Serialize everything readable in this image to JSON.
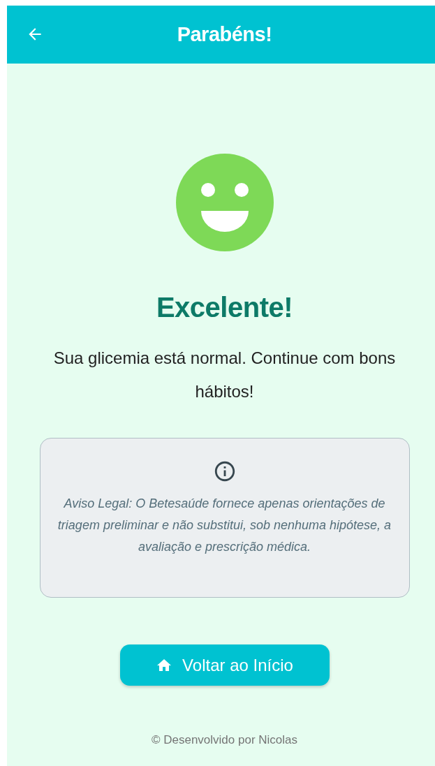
{
  "app_bar": {
    "title": "Parabéns!"
  },
  "result": {
    "heading": "Excelente!",
    "message": "Sua glicemia está normal. Continue com bons hábitos!"
  },
  "disclaimer": {
    "text": "Aviso Legal: O Betesaúde fornece apenas orientações de triagem preliminar e não substitui, sob nenhuma hipótese, a avaliação e prescrição médica."
  },
  "home_button": {
    "label": "Voltar ao Início"
  },
  "footer": {
    "text": "© Desenvolvido por Nicolas"
  }
}
